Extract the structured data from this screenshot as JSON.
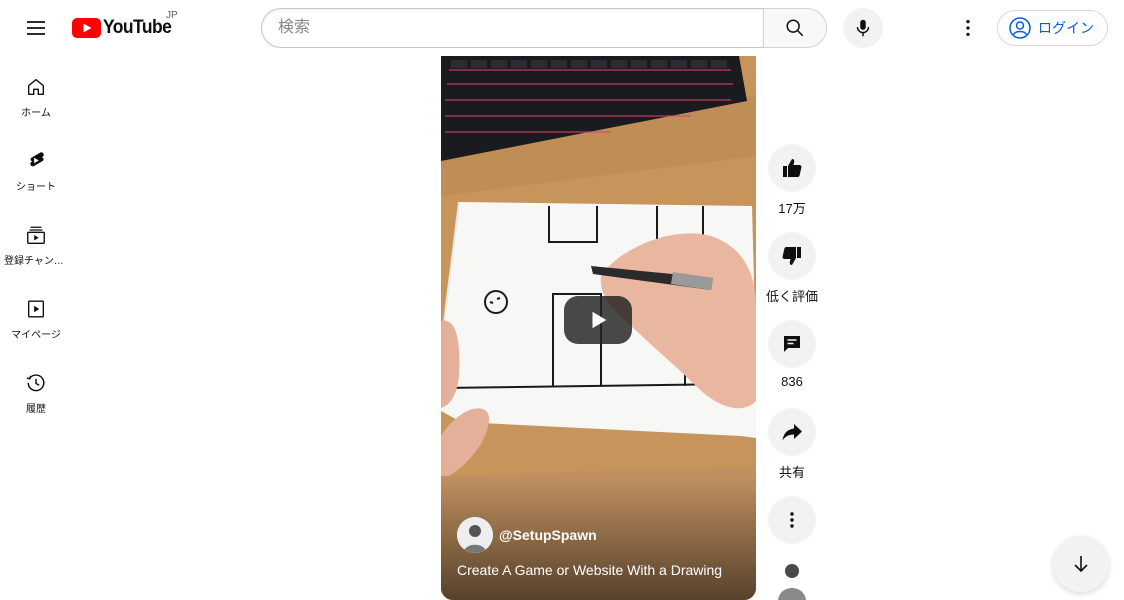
{
  "header": {
    "logo_text": "YouTube",
    "country_code": "JP",
    "search_placeholder": "検索",
    "login_label": "ログイン"
  },
  "sidebar": {
    "items": [
      {
        "label": "ホーム",
        "icon": "home-icon"
      },
      {
        "label": "ショート",
        "icon": "shorts-icon"
      },
      {
        "label": "登録チャンネル",
        "icon": "subscriptions-icon"
      },
      {
        "label": "マイページ",
        "icon": "library-icon"
      },
      {
        "label": "履歴",
        "icon": "history-icon"
      }
    ]
  },
  "video": {
    "channel_handle": "@SetupSpawn",
    "title": "Create A Game or Website With a Drawing"
  },
  "actions": {
    "like_count": "17万",
    "dislike_label": "低く評価",
    "comment_count": "836",
    "share_label": "共有"
  },
  "colors": {
    "brand_red": "#ff0000",
    "link_blue": "#065fd4",
    "button_gray": "#f2f2f2"
  }
}
